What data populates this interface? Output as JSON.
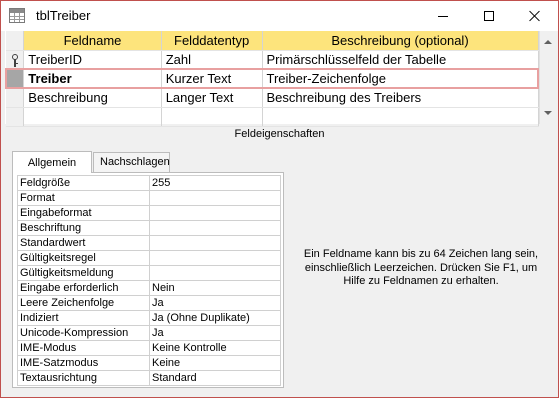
{
  "window": {
    "title": "tblTreiber"
  },
  "grid": {
    "headers": [
      "Feldname",
      "Felddatentyp",
      "Beschreibung (optional)"
    ],
    "rows": [
      {
        "name": "TreiberID",
        "type": "Zahl",
        "description": "Primärschlüsselfeld der Tabelle",
        "primary_key": true
      },
      {
        "name": "Treiber",
        "type": "Kurzer Text",
        "description": "Treiber-Zeichenfolge",
        "selected": true
      },
      {
        "name": "Beschreibung",
        "type": "Langer Text",
        "description": "Beschreibung des Treibers"
      }
    ]
  },
  "section_title": "Feldeigenschaften",
  "tabs": [
    "Allgemein",
    "Nachschlagen"
  ],
  "properties": [
    {
      "label": "Feldgröße",
      "value": "255"
    },
    {
      "label": "Format",
      "value": ""
    },
    {
      "label": "Eingabeformat",
      "value": ""
    },
    {
      "label": "Beschriftung",
      "value": ""
    },
    {
      "label": "Standardwert",
      "value": ""
    },
    {
      "label": "Gültigkeitsregel",
      "value": ""
    },
    {
      "label": "Gültigkeitsmeldung",
      "value": ""
    },
    {
      "label": "Eingabe erforderlich",
      "value": "Nein"
    },
    {
      "label": "Leere Zeichenfolge",
      "value": "Ja"
    },
    {
      "label": "Indiziert",
      "value": "Ja (Ohne Duplikate)"
    },
    {
      "label": "Unicode-Kompression",
      "value": "Ja"
    },
    {
      "label": "IME-Modus",
      "value": "Keine Kontrolle"
    },
    {
      "label": "IME-Satzmodus",
      "value": "Keine"
    },
    {
      "label": "Textausrichtung",
      "value": "Standard"
    }
  ],
  "help_text": "Ein Feldname kann bis zu 64 Zeichen lang sein, einschließlich Leerzeichen. Drücken Sie F1, um Hilfe zu Feldnamen zu erhalten.",
  "colors": {
    "header": "#fde47c",
    "selection_border": "#e8a0a0",
    "window_border": "#c0504d"
  }
}
